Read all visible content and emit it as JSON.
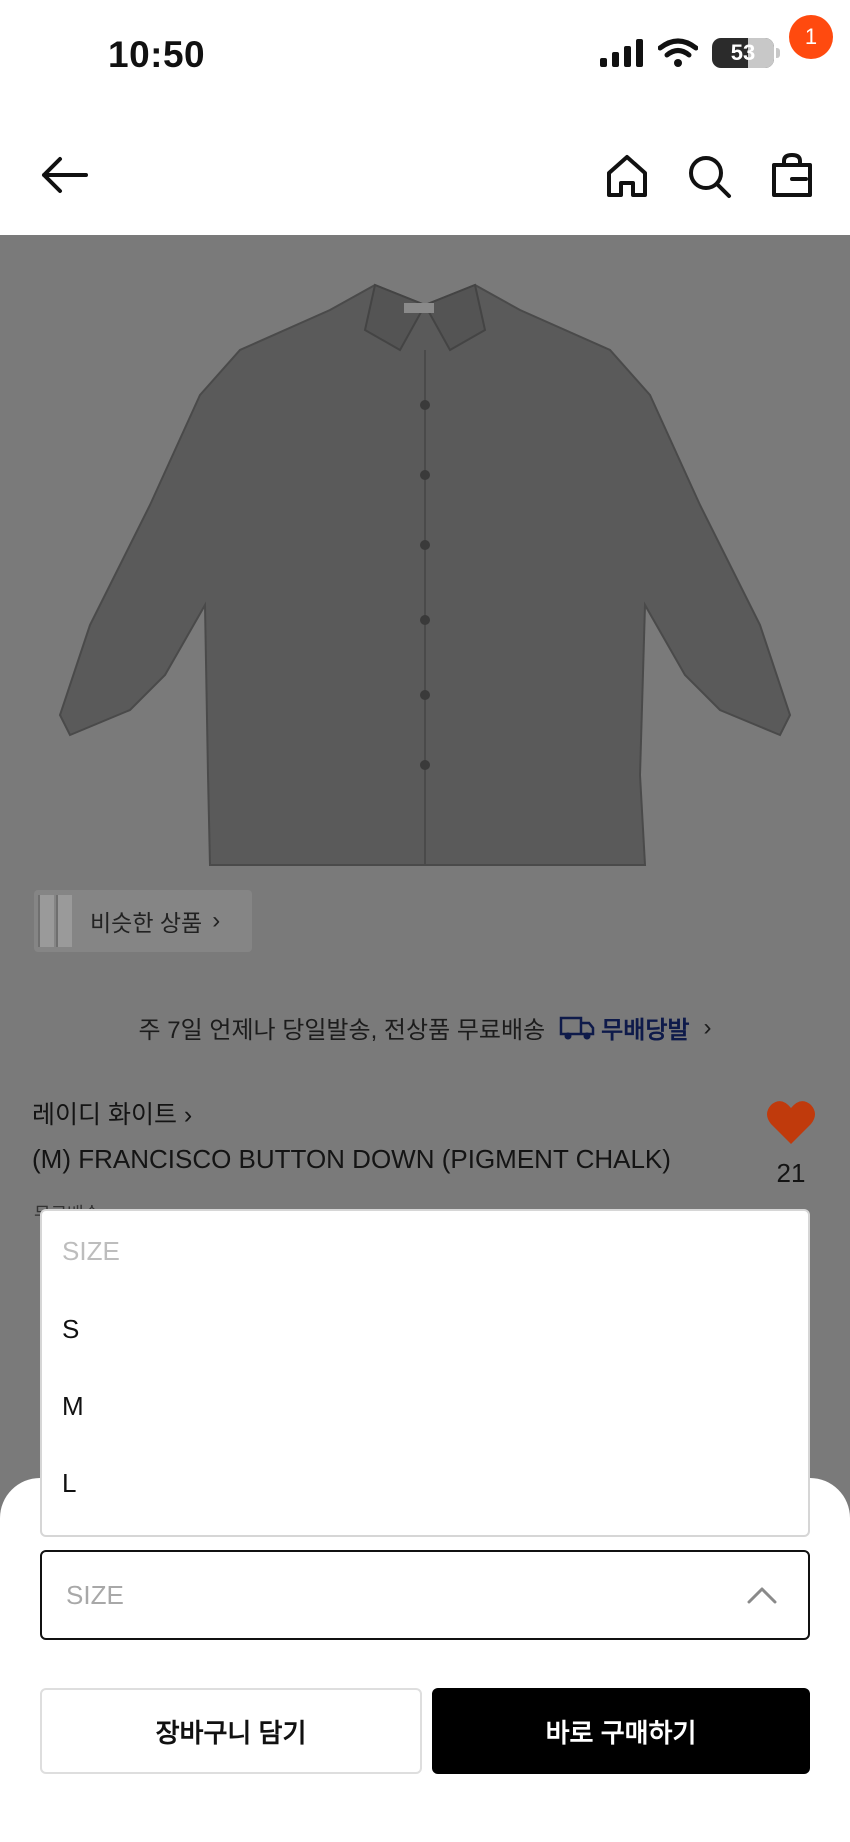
{
  "status_bar": {
    "time": "10:50",
    "battery": "53"
  },
  "nav": {
    "cart_count": "1"
  },
  "product": {
    "similar_label": "비슷한 상품",
    "delivery_text": "주 7일 언제나 당일발송, 전상품 무료배송",
    "delivery_logo": "무배당발",
    "brand": "레이디 화이트",
    "name": "(M) FRANCISCO BUTTON DOWN (PIGMENT CHALK)",
    "like_count": "21",
    "peek_text": "무료배송"
  },
  "size_dropdown": {
    "placeholder": "SIZE",
    "options": [
      {
        "label": "S"
      },
      {
        "label": "M"
      },
      {
        "label": "L"
      }
    ]
  },
  "size_select": {
    "value": "SIZE"
  },
  "actions": {
    "add_to_cart": "장바구니 담기",
    "buy_now": "바로 구매하기"
  },
  "colors": {
    "badge": "#ff4a0f",
    "heart": "#c03a0c",
    "overlay": "#7a7a7a"
  },
  "icons": [
    "back-arrow-icon",
    "home-icon",
    "search-icon",
    "shopping-bag-icon",
    "heart-icon",
    "chevron-up-icon",
    "signal-icon",
    "wifi-icon",
    "battery-icon",
    "truck-icon"
  ]
}
